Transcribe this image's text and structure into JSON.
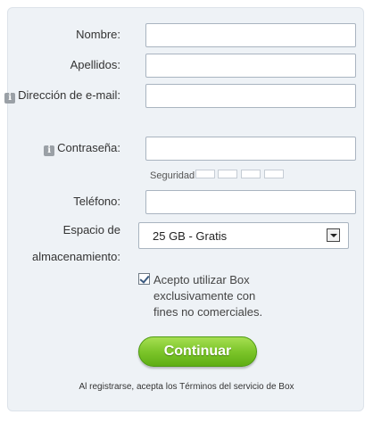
{
  "form": {
    "first_name": {
      "label": "Nombre:",
      "value": ""
    },
    "last_name": {
      "label": "Apellidos:",
      "value": ""
    },
    "email": {
      "label": "Dirección de e-mail:",
      "value": ""
    },
    "password": {
      "label": "Contraseña:",
      "value": ""
    },
    "security": {
      "label": "Seguridad",
      "segments": 4,
      "level": 0
    },
    "phone": {
      "label": "Teléfono:",
      "value": ""
    },
    "storage": {
      "label": "Espacio de almacenamiento:",
      "selected": "25 GB - Gratis"
    },
    "terms_checkbox": {
      "checked": true,
      "text": "Acepto utilizar Box exclusivamente con fines no comerciales."
    },
    "submit_label": "Continuar",
    "footer_text": "Al registrarse, acepta los Términos del servicio de Box"
  },
  "icons": {
    "info": "info-icon",
    "dropdown": "chevron-down-icon",
    "checkbox": "checkmark-icon"
  },
  "colors": {
    "panel_bg": "#eef2f6",
    "button_green": "#7cc52a"
  }
}
